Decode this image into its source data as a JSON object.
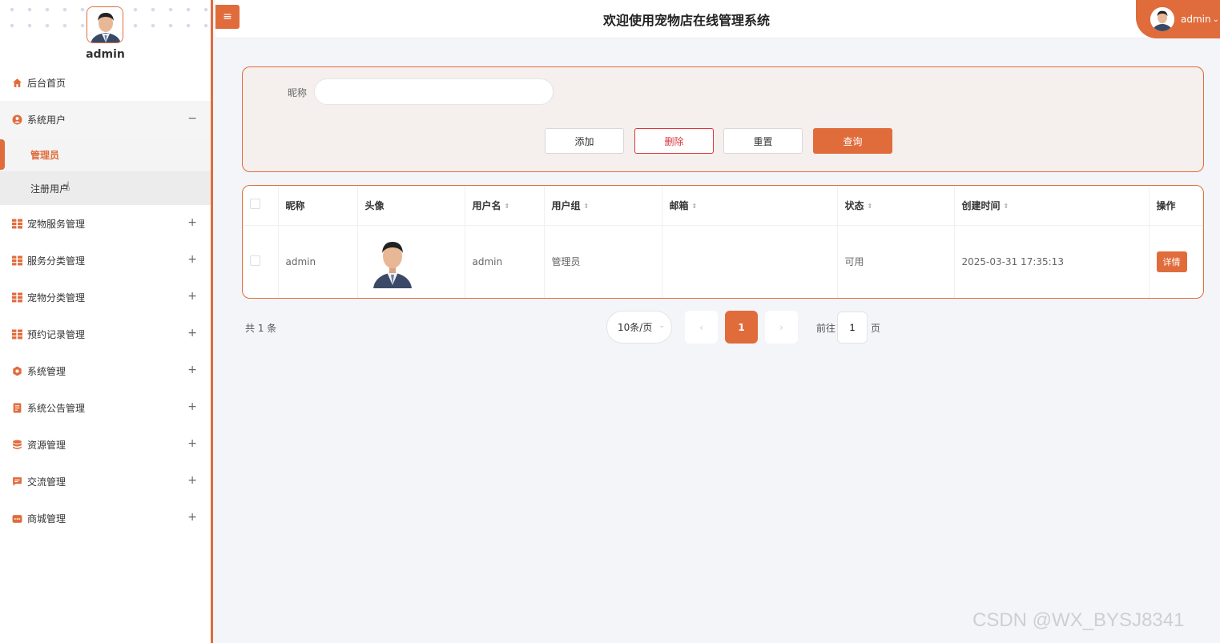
{
  "sidebar": {
    "user_name": "admin",
    "menu": [
      {
        "label": "后台首页",
        "icon": "home-icon",
        "sign": ""
      },
      {
        "label": "系统用户",
        "icon": "user-circle-icon",
        "sign": "−"
      },
      {
        "label": "宠物服务管理",
        "icon": "grid-icon",
        "sign": "+"
      },
      {
        "label": "服务分类管理",
        "icon": "grid-icon",
        "sign": "+"
      },
      {
        "label": "宠物分类管理",
        "icon": "grid-icon",
        "sign": "+"
      },
      {
        "label": "预约记录管理",
        "icon": "grid-icon",
        "sign": "+"
      },
      {
        "label": "系统管理",
        "icon": "gear-icon",
        "sign": "+"
      },
      {
        "label": "系统公告管理",
        "icon": "document-icon",
        "sign": "+"
      },
      {
        "label": "资源管理",
        "icon": "database-icon",
        "sign": "+"
      },
      {
        "label": "交流管理",
        "icon": "chat-icon",
        "sign": "+"
      },
      {
        "label": "商城管理",
        "icon": "shop-icon",
        "sign": "+"
      }
    ],
    "submenu": [
      "管理员",
      "注册用户"
    ]
  },
  "header": {
    "toggle_icon": "≡",
    "title": "欢迎使用宠物店在线管理系统",
    "user": "admin",
    "chevron": "⌄"
  },
  "search": {
    "label": "昵称",
    "value": "",
    "buttons": {
      "add": "添加",
      "delete": "删除",
      "reset": "重置",
      "query": "查询"
    }
  },
  "table": {
    "columns": [
      "昵称",
      "头像",
      "用户名",
      "用户组",
      "邮箱",
      "状态",
      "创建时间",
      "操作"
    ],
    "sort_icon": "⇕",
    "rows": [
      {
        "nickname": "admin",
        "username": "admin",
        "group": "管理员",
        "email": "",
        "status": "可用",
        "created": "2025-03-31 17:35:13",
        "action": "详情"
      }
    ]
  },
  "pagination": {
    "total": "共 1 条",
    "page_size": "10条/页",
    "prev": "‹",
    "current": "1",
    "next": "›",
    "goto_label": "前往",
    "goto_value": "1",
    "unit": "页"
  },
  "watermark": "CSDN @WX_BYSJ8341",
  "colors": {
    "accent": "#e06c3c",
    "danger": "#d9363e",
    "panel_bg": "#f5efed"
  }
}
